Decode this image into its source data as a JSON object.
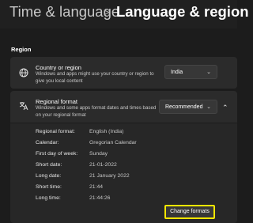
{
  "header": {
    "parent": "Time & language",
    "separator": ">",
    "current": "Language & region"
  },
  "region": {
    "section_label": "Region",
    "country": {
      "title": "Country or region",
      "description": "Windows and apps might use your country or region to give you local content",
      "selected": "India",
      "icon": "globe-icon"
    },
    "regional_format": {
      "title": "Regional format",
      "description": "Windows and some apps format dates and times based on your regional format",
      "selected": "Recommended",
      "icon": "regional-format-icon",
      "expanded": true
    }
  },
  "formats": [
    {
      "label": "Regional format:",
      "value": "English (India)"
    },
    {
      "label": "Calendar:",
      "value": "Gregorian Calendar"
    },
    {
      "label": "First day of week:",
      "value": "Sunday"
    },
    {
      "label": "Short date:",
      "value": "21-01-2022"
    },
    {
      "label": "Long date:",
      "value": "21 January 2022"
    },
    {
      "label": "Short time:",
      "value": "21:44"
    },
    {
      "label": "Long time:",
      "value": "21:44:26"
    }
  ],
  "change_formats_label": "Change formats",
  "colors": {
    "background": "#1c1c1c",
    "card": "#2b2b2b",
    "highlight": "#f5e600"
  }
}
